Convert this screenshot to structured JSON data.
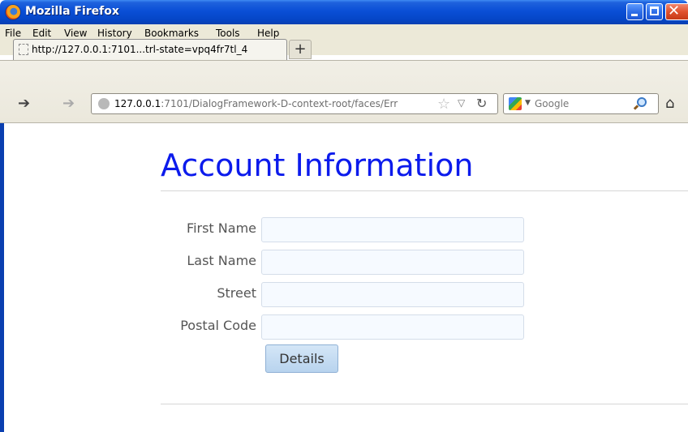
{
  "window": {
    "title": "Mozilla Firefox"
  },
  "menu": [
    "File",
    "Edit",
    "View",
    "History",
    "Bookmarks",
    "Tools",
    "Help"
  ],
  "tab": {
    "label": "http://127.0.0.1:7101...trl-state=vpq4fr7tl_4",
    "new_tab": "+"
  },
  "nav": {
    "url_host": "127.0.0.1",
    "url_path": ":7101/DialogFramework-D-context-root/faces/Err",
    "search_placeholder": "Google",
    "icons": [
      "back-icon",
      "forward-icon",
      "site-identity-icon",
      "star-icon",
      "dropdown-icon",
      "reload-icon",
      "google-icon",
      "magnifier-icon",
      "home-icon"
    ]
  },
  "page": {
    "title": "Account Information",
    "fields": [
      {
        "label": "First Name",
        "value": ""
      },
      {
        "label": "Last Name",
        "value": ""
      },
      {
        "label": "Street",
        "value": ""
      },
      {
        "label": "Postal Code",
        "value": ""
      }
    ],
    "details_button": "Details"
  },
  "colors": {
    "title": "#0c1bec",
    "titlebar": "#0a4fd6",
    "button": "#b8d3ee"
  }
}
